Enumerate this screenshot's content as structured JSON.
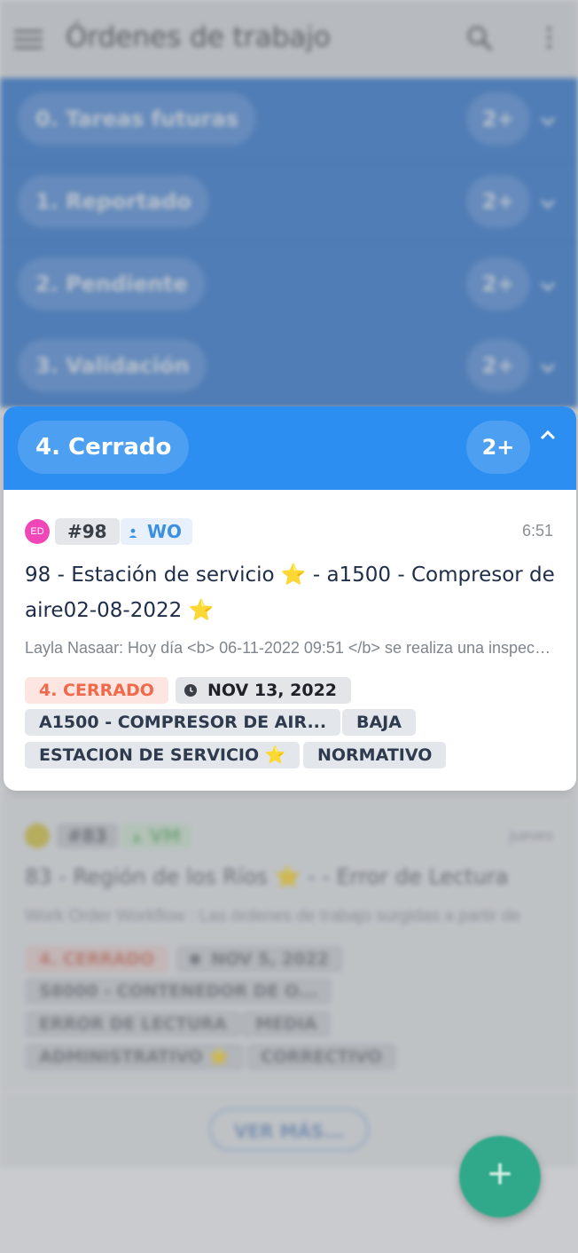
{
  "app_bar": {
    "title": "Órdenes de trabajo",
    "icons": {
      "menu": "menu-icon",
      "search": "search-icon",
      "more": "more-vert-icon"
    }
  },
  "status_groups": [
    {
      "label": "0. Tareas futuras",
      "count": "2+",
      "expanded": false
    },
    {
      "label": "1. Reportado",
      "count": "2+",
      "expanded": false
    },
    {
      "label": "2. Pendiente",
      "count": "2+",
      "expanded": false
    },
    {
      "label": "3. Validación",
      "count": "2+",
      "expanded": false
    },
    {
      "label": "4. Cerrado",
      "count": "2+",
      "expanded": true
    }
  ],
  "focused_card": {
    "avatar_initials": "ED",
    "number": "#98",
    "type": "WO",
    "time": "6:51",
    "title": "98 - Estación de servicio ⭐ - a1500 - Compresor de aire02-08-2022 ⭐",
    "description": "Layla Nasaar: Hoy día <b> 06-11-2022 09:51 </b> se realiza una inspección",
    "status_tag": "4. CERRADO",
    "date_tag": "NOV 13, 2022",
    "tags": [
      "A1500 - COMPRESOR DE AIR...",
      "BAJA",
      "ESTACION DE SERVICIO ⭐",
      "NORMATIVO"
    ]
  },
  "background_card": {
    "number": "#83",
    "type": "VM",
    "time": "jueves",
    "title": "83 - Región de los Ríos ⭐ - - Error de Lectura",
    "description": "Work Order Workflow : Las órdenes de trabajo surgidas a partir de",
    "status_tag": "4. CERRADO",
    "date_tag": "NOV 5, 2022",
    "tags": [
      "S8000 - CONTENEDOR DE O...",
      "ERROR DE LECTURA",
      "MEDIA",
      "ADMINISTRATIVO ⭐",
      "CORRECTIVO"
    ]
  },
  "footer": {
    "load_more": "VER MÁS..."
  },
  "fab": {
    "symbol": "+"
  },
  "colors": {
    "primary": "#2b8ef0",
    "band": "#3b7dd1",
    "status": "#f0694a",
    "fab": "#2fa98a",
    "avatar": "#f046b8"
  }
}
